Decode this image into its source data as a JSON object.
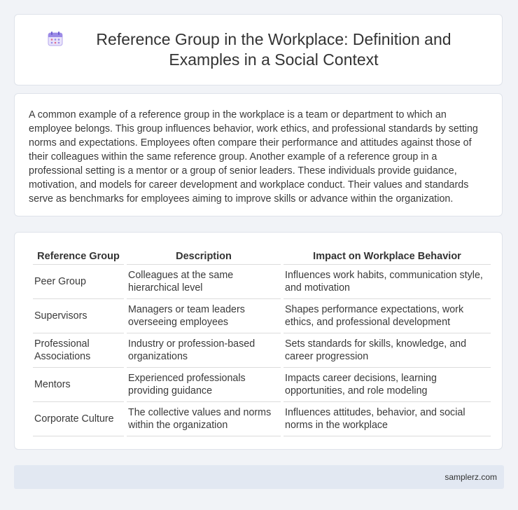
{
  "header": {
    "title": "Reference Group in the Workplace: Definition and Examples in a Social Context",
    "icon": "calendar-icon"
  },
  "intro": {
    "text": "A common example of a reference group in the workplace is a team or department to which an employee belongs. This group influences behavior, work ethics, and professional standards by setting norms and expectations. Employees often compare their performance and attitudes against those of their colleagues within the same reference group. Another example of a reference group in a professional setting is a mentor or a group of senior leaders. These individuals provide guidance, motivation, and models for career development and workplace conduct. Their values and standards serve as benchmarks for employees aiming to improve skills or advance within the organization."
  },
  "table": {
    "headers": [
      "Reference Group",
      "Description",
      "Impact on Workplace Behavior"
    ],
    "rows": [
      [
        "Peer Group",
        "Colleagues at the same hierarchical level",
        "Influences work habits, communication style, and motivation"
      ],
      [
        "Supervisors",
        "Managers or team leaders overseeing employees",
        "Shapes performance expectations, work ethics, and professional development"
      ],
      [
        "Professional Associations",
        "Industry or profession-based organizations",
        "Sets standards for skills, knowledge, and career progression"
      ],
      [
        "Mentors",
        "Experienced professionals providing guidance",
        "Impacts career decisions, learning opportunities, and role modeling"
      ],
      [
        "Corporate Culture",
        "The collective values and norms within the organization",
        "Influences attitudes, behavior, and social norms in the workplace"
      ]
    ]
  },
  "footer": {
    "site": "samplerz.com"
  },
  "colors": {
    "background": "#f1f3f7",
    "card": "#ffffff",
    "footer": "#e2e8f2",
    "icon_accent": "#8c7be0"
  }
}
